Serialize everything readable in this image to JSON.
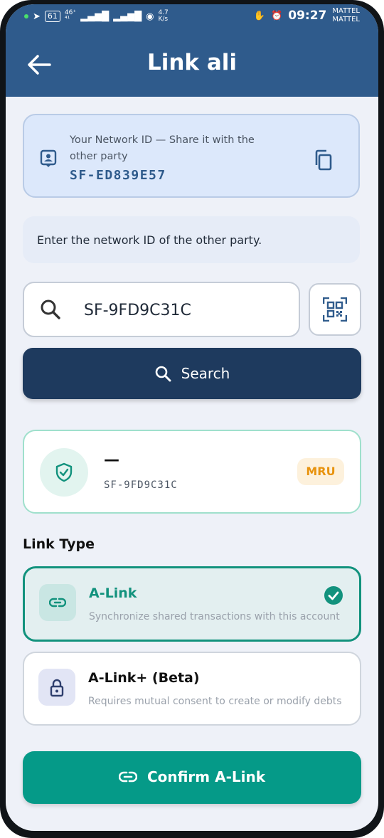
{
  "status_bar": {
    "battery": "61",
    "net_type": "46⁺",
    "net_sub": "⁴¹",
    "speed_value": "4.7",
    "speed_unit": "K/s",
    "time": "09:27",
    "carrier_1": "MATTEL",
    "carrier_2": "MATTEL"
  },
  "header": {
    "title": "Link ali"
  },
  "network_id_card": {
    "label": "Your Network ID — Share it with the other party",
    "value": "SF-ED839E57"
  },
  "hint": "Enter the network ID of the other party.",
  "search": {
    "value": "SF-9FD9C31C",
    "button_label": "Search"
  },
  "found_party": {
    "name": "—",
    "id": "SF-9FD9C31C",
    "currency": "MRU"
  },
  "link_type": {
    "title": "Link Type",
    "options": [
      {
        "label": "A-Link",
        "description": "Synchronize shared transactions with this account",
        "selected": true
      },
      {
        "label": "A-Link+ (Beta)",
        "description": "Requires mutual consent to create or modify debts",
        "selected": false
      }
    ]
  },
  "confirm_button": {
    "label": "Confirm A-Link"
  },
  "colors": {
    "header": "#2f5b8c",
    "primary_dark": "#1e3a5e",
    "teal": "#059a88",
    "accent_orange": "#e8930e"
  }
}
